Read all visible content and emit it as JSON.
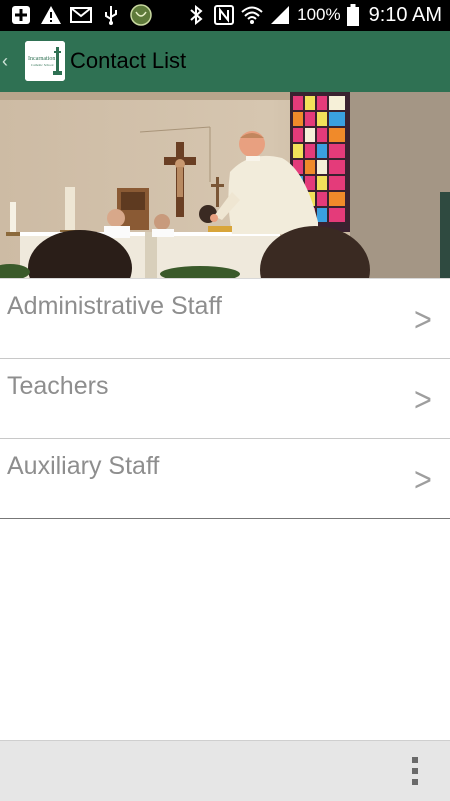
{
  "status_bar": {
    "battery_percent": "100%",
    "time": "9:10 AM",
    "icons": [
      "add-icon",
      "warning-icon",
      "mail-icon",
      "usb-icon",
      "shield-icon",
      "bluetooth-icon",
      "nfc-icon",
      "wifi-icon",
      "signal-icon",
      "battery-icon"
    ]
  },
  "action_bar": {
    "title": "Contact List",
    "logo_text": "Incarnation Catholic School",
    "background": "#2f7153"
  },
  "list": {
    "items": [
      {
        "label": "Administrative Staff",
        "chevron": ">"
      },
      {
        "label": "Teachers",
        "chevron": ">"
      },
      {
        "label": "Auxiliary Staff",
        "chevron": ">"
      }
    ]
  },
  "bottom_bar": {
    "menu_icon": "overflow-menu-icon"
  }
}
